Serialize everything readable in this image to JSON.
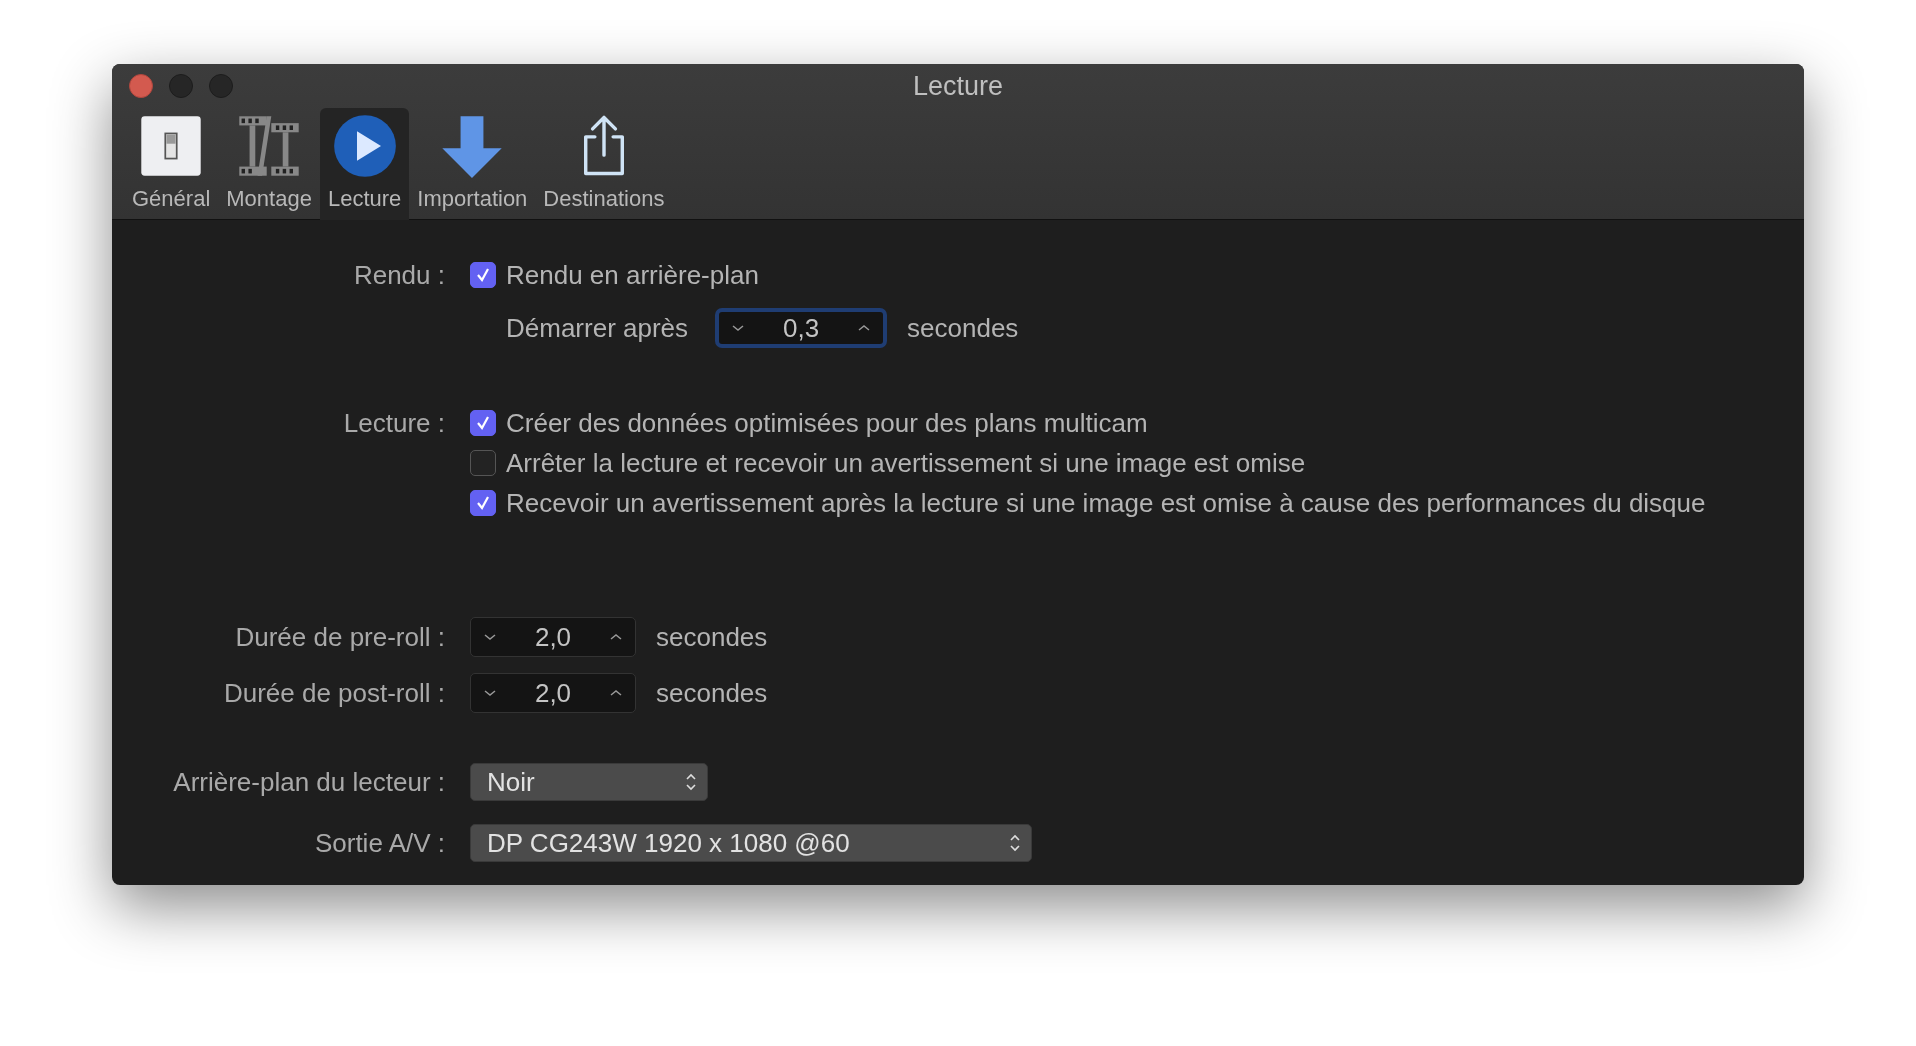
{
  "window": {
    "title": "Lecture"
  },
  "toolbar": [
    {
      "label": "Général",
      "kind": "switch",
      "selected": false
    },
    {
      "label": "Montage",
      "kind": "film",
      "selected": false
    },
    {
      "label": "Lecture",
      "kind": "play",
      "selected": true
    },
    {
      "label": "Importation",
      "kind": "download",
      "selected": false
    },
    {
      "label": "Destinations",
      "kind": "share",
      "selected": false
    }
  ],
  "render": {
    "label": "Rendu :",
    "option": {
      "text": "Rendu en arrière-plan",
      "checked": true
    },
    "start_after": {
      "label": "Démarrer après",
      "value": "0,3",
      "unit": "secondes",
      "focused": true
    }
  },
  "playback": {
    "label": "Lecture :",
    "options": [
      {
        "text": "Créer des données optimisées pour des plans multicam",
        "checked": true
      },
      {
        "text": "Arrêter la lecture et recevoir un avertissement si une image est omise",
        "checked": false
      },
      {
        "text": "Recevoir un avertissement après la lecture si une image est omise à cause des performances du disque",
        "checked": true
      }
    ]
  },
  "durations": [
    {
      "label": "Durée de pre-roll :",
      "value": "2,0",
      "unit": "secondes",
      "focused": false
    },
    {
      "label": "Durée de post-roll :",
      "value": "2,0",
      "unit": "secondes",
      "focused": false
    }
  ],
  "popups": [
    {
      "label": "Arrière-plan du lecteur :",
      "value": "Noir",
      "wide": false
    },
    {
      "label": "Sortie A/V :",
      "value": "DP CG243W 1920 x 1080 @60",
      "wide": true
    }
  ]
}
